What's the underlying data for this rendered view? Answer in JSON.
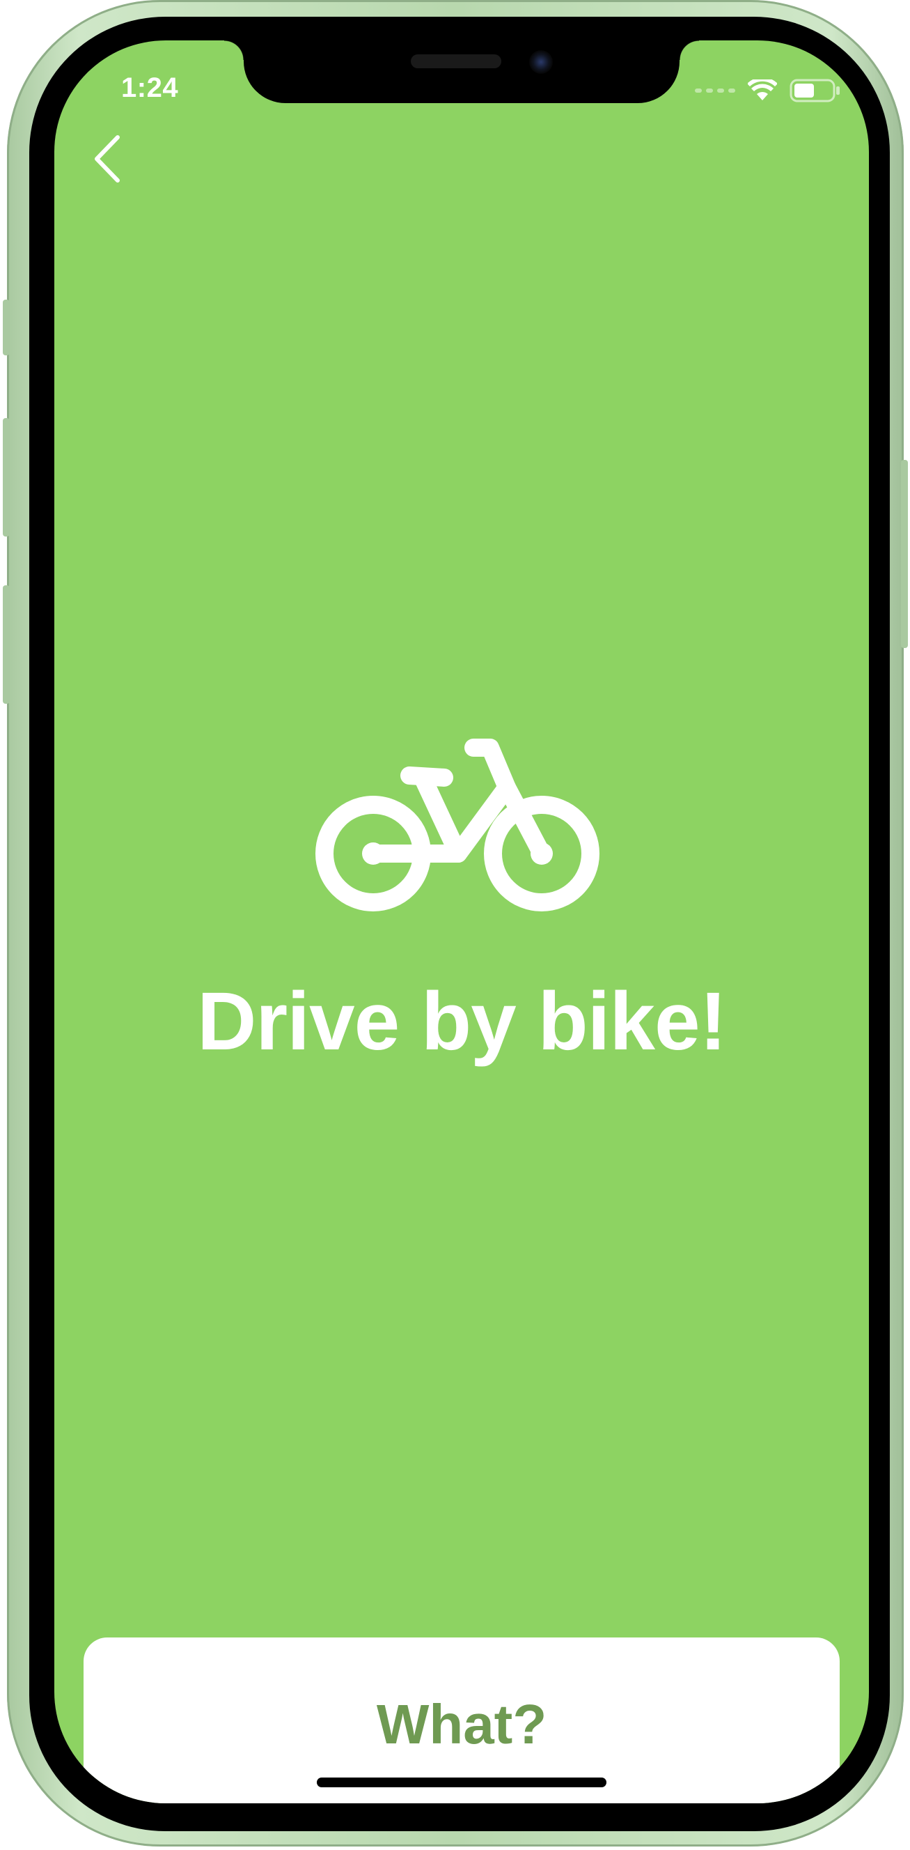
{
  "colors": {
    "screen_background": "#8dd362",
    "accent_text": "#6f9a52",
    "frame": "#b8d8ae"
  },
  "status_bar": {
    "time": "1:24",
    "icons": [
      "signal-icon",
      "wifi-icon",
      "battery-icon"
    ]
  },
  "nav": {
    "back_icon": "chevron-left-icon"
  },
  "hero": {
    "icon": "bicycle-icon",
    "title": "Drive by bike!"
  },
  "bottom": {
    "button_label": "What?"
  }
}
